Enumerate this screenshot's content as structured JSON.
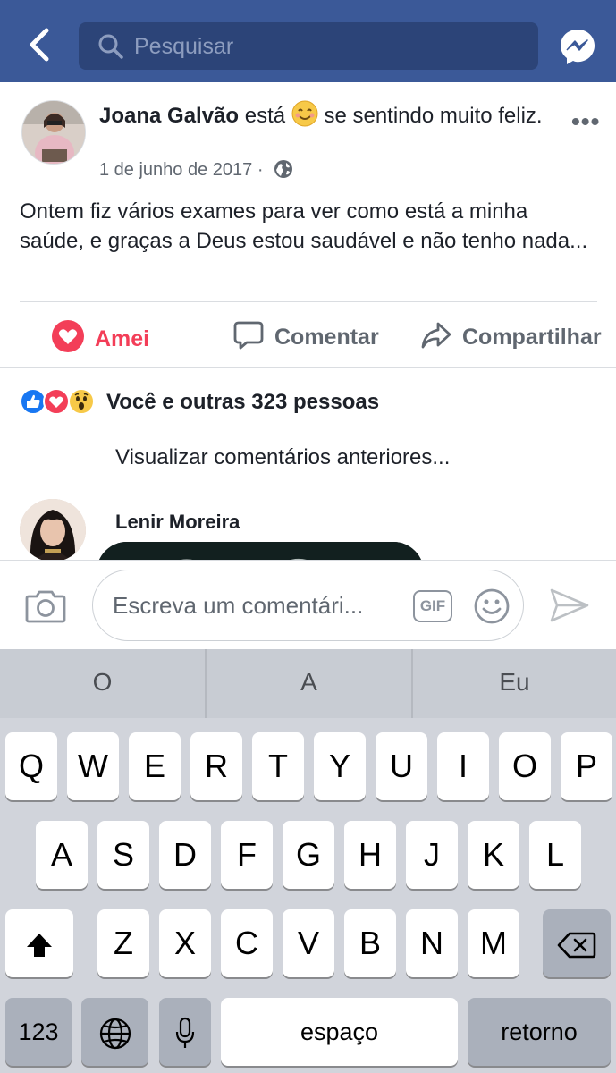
{
  "search": {
    "placeholder": "Pesquisar"
  },
  "post": {
    "author": "Joana Galvão",
    "feeling_prefix": "está",
    "feeling_text": "se sentindo muito feliz.",
    "date": "1 de junho de 2017",
    "date_separator": "·",
    "text": "Ontem fiz vários exames para ver como está a minha saúde, e graças a Deus estou saudável e não tenho nada...",
    "more_label": "•••"
  },
  "actions": {
    "love": "Amei",
    "comment": "Comentar",
    "share": "Compartilhar"
  },
  "reactions": {
    "summary": "Você e outras 323 pessoas"
  },
  "comments": {
    "view_previous": "Visualizar comentários anteriores...",
    "items": [
      {
        "author": "Lenir Moreira"
      }
    ]
  },
  "composer": {
    "placeholder": "Escreva um comentári...",
    "gif_label": "GIF"
  },
  "keyboard": {
    "suggestions": [
      "O",
      "A",
      "Eu"
    ],
    "row1": [
      "Q",
      "W",
      "E",
      "R",
      "T",
      "Y",
      "U",
      "I",
      "O",
      "P"
    ],
    "row2": [
      "A",
      "S",
      "D",
      "F",
      "G",
      "H",
      "J",
      "K",
      "L"
    ],
    "row3": [
      "Z",
      "X",
      "C",
      "V",
      "B",
      "N",
      "M"
    ],
    "numbers": "123",
    "space": "espaço",
    "return": "retorno"
  },
  "colors": {
    "brand": "#3b5998",
    "love": "#f33e58",
    "like": "#1877f2"
  },
  "icons": [
    "back-icon",
    "search-icon",
    "messenger-icon",
    "smiling-emoji-icon",
    "more-icon",
    "globe-icon",
    "heart-icon",
    "comment-icon",
    "share-icon",
    "like-reaction-icon",
    "love-reaction-icon",
    "wow-reaction-icon",
    "camera-icon",
    "gif-icon",
    "smiley-icon",
    "send-icon",
    "shift-icon",
    "delete-icon",
    "globe-keyboard-icon",
    "microphone-icon"
  ]
}
